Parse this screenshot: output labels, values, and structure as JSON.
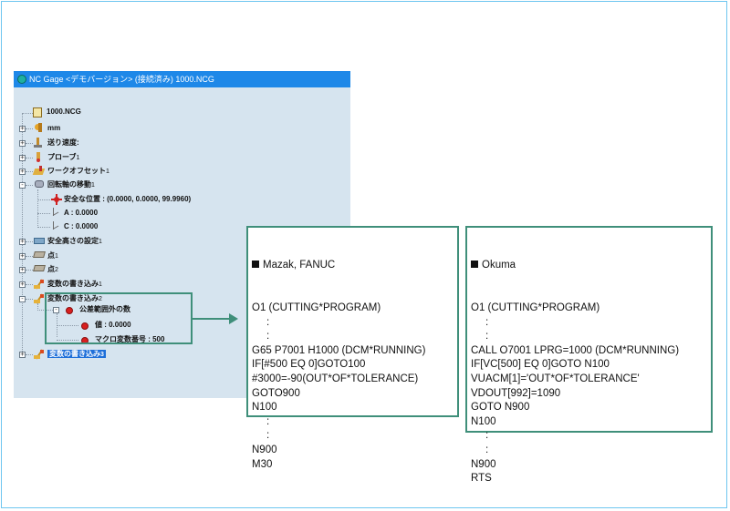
{
  "window": {
    "title": "NC Gage <デモバージョン> (接続済み)  1000.NCG"
  },
  "tree": {
    "root": "1000.NCG",
    "nodes": [
      {
        "label": "mm",
        "bold": true
      },
      {
        "label": "送り速度:",
        "bold": true
      },
      {
        "label": "プローブ",
        "suffix": "1",
        "bold": true
      },
      {
        "label": "ワークオフセット",
        "suffix": "1",
        "bold": true
      },
      {
        "label": "回転軸の移動",
        "suffix": "1",
        "bold": true
      },
      {
        "label": "安全な位置 : (0.0000, 0.0000, 99.9960)",
        "bold": true
      },
      {
        "label": "A : 0.0000",
        "bold": true
      },
      {
        "label": "C : 0.0000",
        "bold": true
      },
      {
        "label": "安全高さの設定",
        "suffix": "1",
        "bold": true
      },
      {
        "label": "点",
        "suffix": "1",
        "bold": true
      },
      {
        "label": "点",
        "suffix": "2",
        "bold": true
      },
      {
        "label": "変数の書き込み",
        "suffix": "1",
        "bold": true
      },
      {
        "label": "変数の書き込み",
        "suffix": "2",
        "bold": true
      },
      {
        "label": "公差範囲外の数",
        "bold": true
      },
      {
        "label": "値 : 0.0000",
        "bold": true
      },
      {
        "label": "マクロ変数番号 : 500",
        "bold": true
      },
      {
        "label": "変数の書き込み",
        "suffix": "3",
        "bold": true
      }
    ]
  },
  "mazak_fanuc": {
    "header": "Mazak, FANUC",
    "lines": [
      "O1 (CUTTING*PROGRAM)",
      "     :",
      "     :",
      "G65 P7001 H1000 (DCM*RUNNING)",
      "IF[#500 EQ 0]GOTO100",
      "#3000=-90(OUT*OF*TOLERANCE)",
      "GOTO900",
      "N100",
      "     :",
      "     :",
      "N900",
      "M30"
    ]
  },
  "okuma": {
    "header": "Okuma",
    "lines": [
      "O1 (CUTTING*PROGRAM)",
      "     :",
      "     :",
      "CALL O7001 LPRG=1000 (DCM*RUNNING)",
      "IF[VC[500] EQ 0]GOTO N100",
      "VUACM[1]='OUT*OF*TOLERANCE'",
      "VDOUT[992]=1090",
      "GOTO N900",
      "N100",
      "     :",
      "     :",
      "N900",
      "RTS"
    ]
  }
}
